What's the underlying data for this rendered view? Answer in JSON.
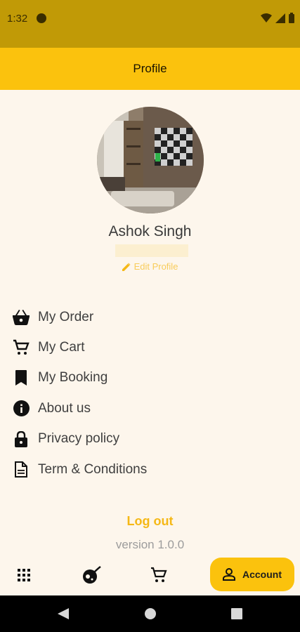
{
  "status_bar": {
    "time": "1:32"
  },
  "app_bar": {
    "title": "Profile"
  },
  "profile": {
    "name": "Ashok Singh",
    "edit_label": "Edit Profile"
  },
  "menu": [
    {
      "label": "My Order",
      "icon": "basket-icon"
    },
    {
      "label": "My Cart",
      "icon": "cart-icon"
    },
    {
      "label": "My Booking",
      "icon": "bookmark-icon"
    },
    {
      "label": "About us",
      "icon": "info-icon"
    },
    {
      "label": "Privacy policy",
      "icon": "lock-icon"
    },
    {
      "label": "Term & Conditions",
      "icon": "document-icon"
    }
  ],
  "logout_label": "Log out",
  "version": "version 1.0.0",
  "bottom_nav": {
    "items": [
      "grid-icon",
      "planet-icon",
      "cart-icon"
    ],
    "account_label": "Account"
  },
  "colors": {
    "accent": "#fbc20d",
    "status_bar": "#c19a06",
    "background": "#fdf6ec",
    "logout": "#f5b816"
  }
}
